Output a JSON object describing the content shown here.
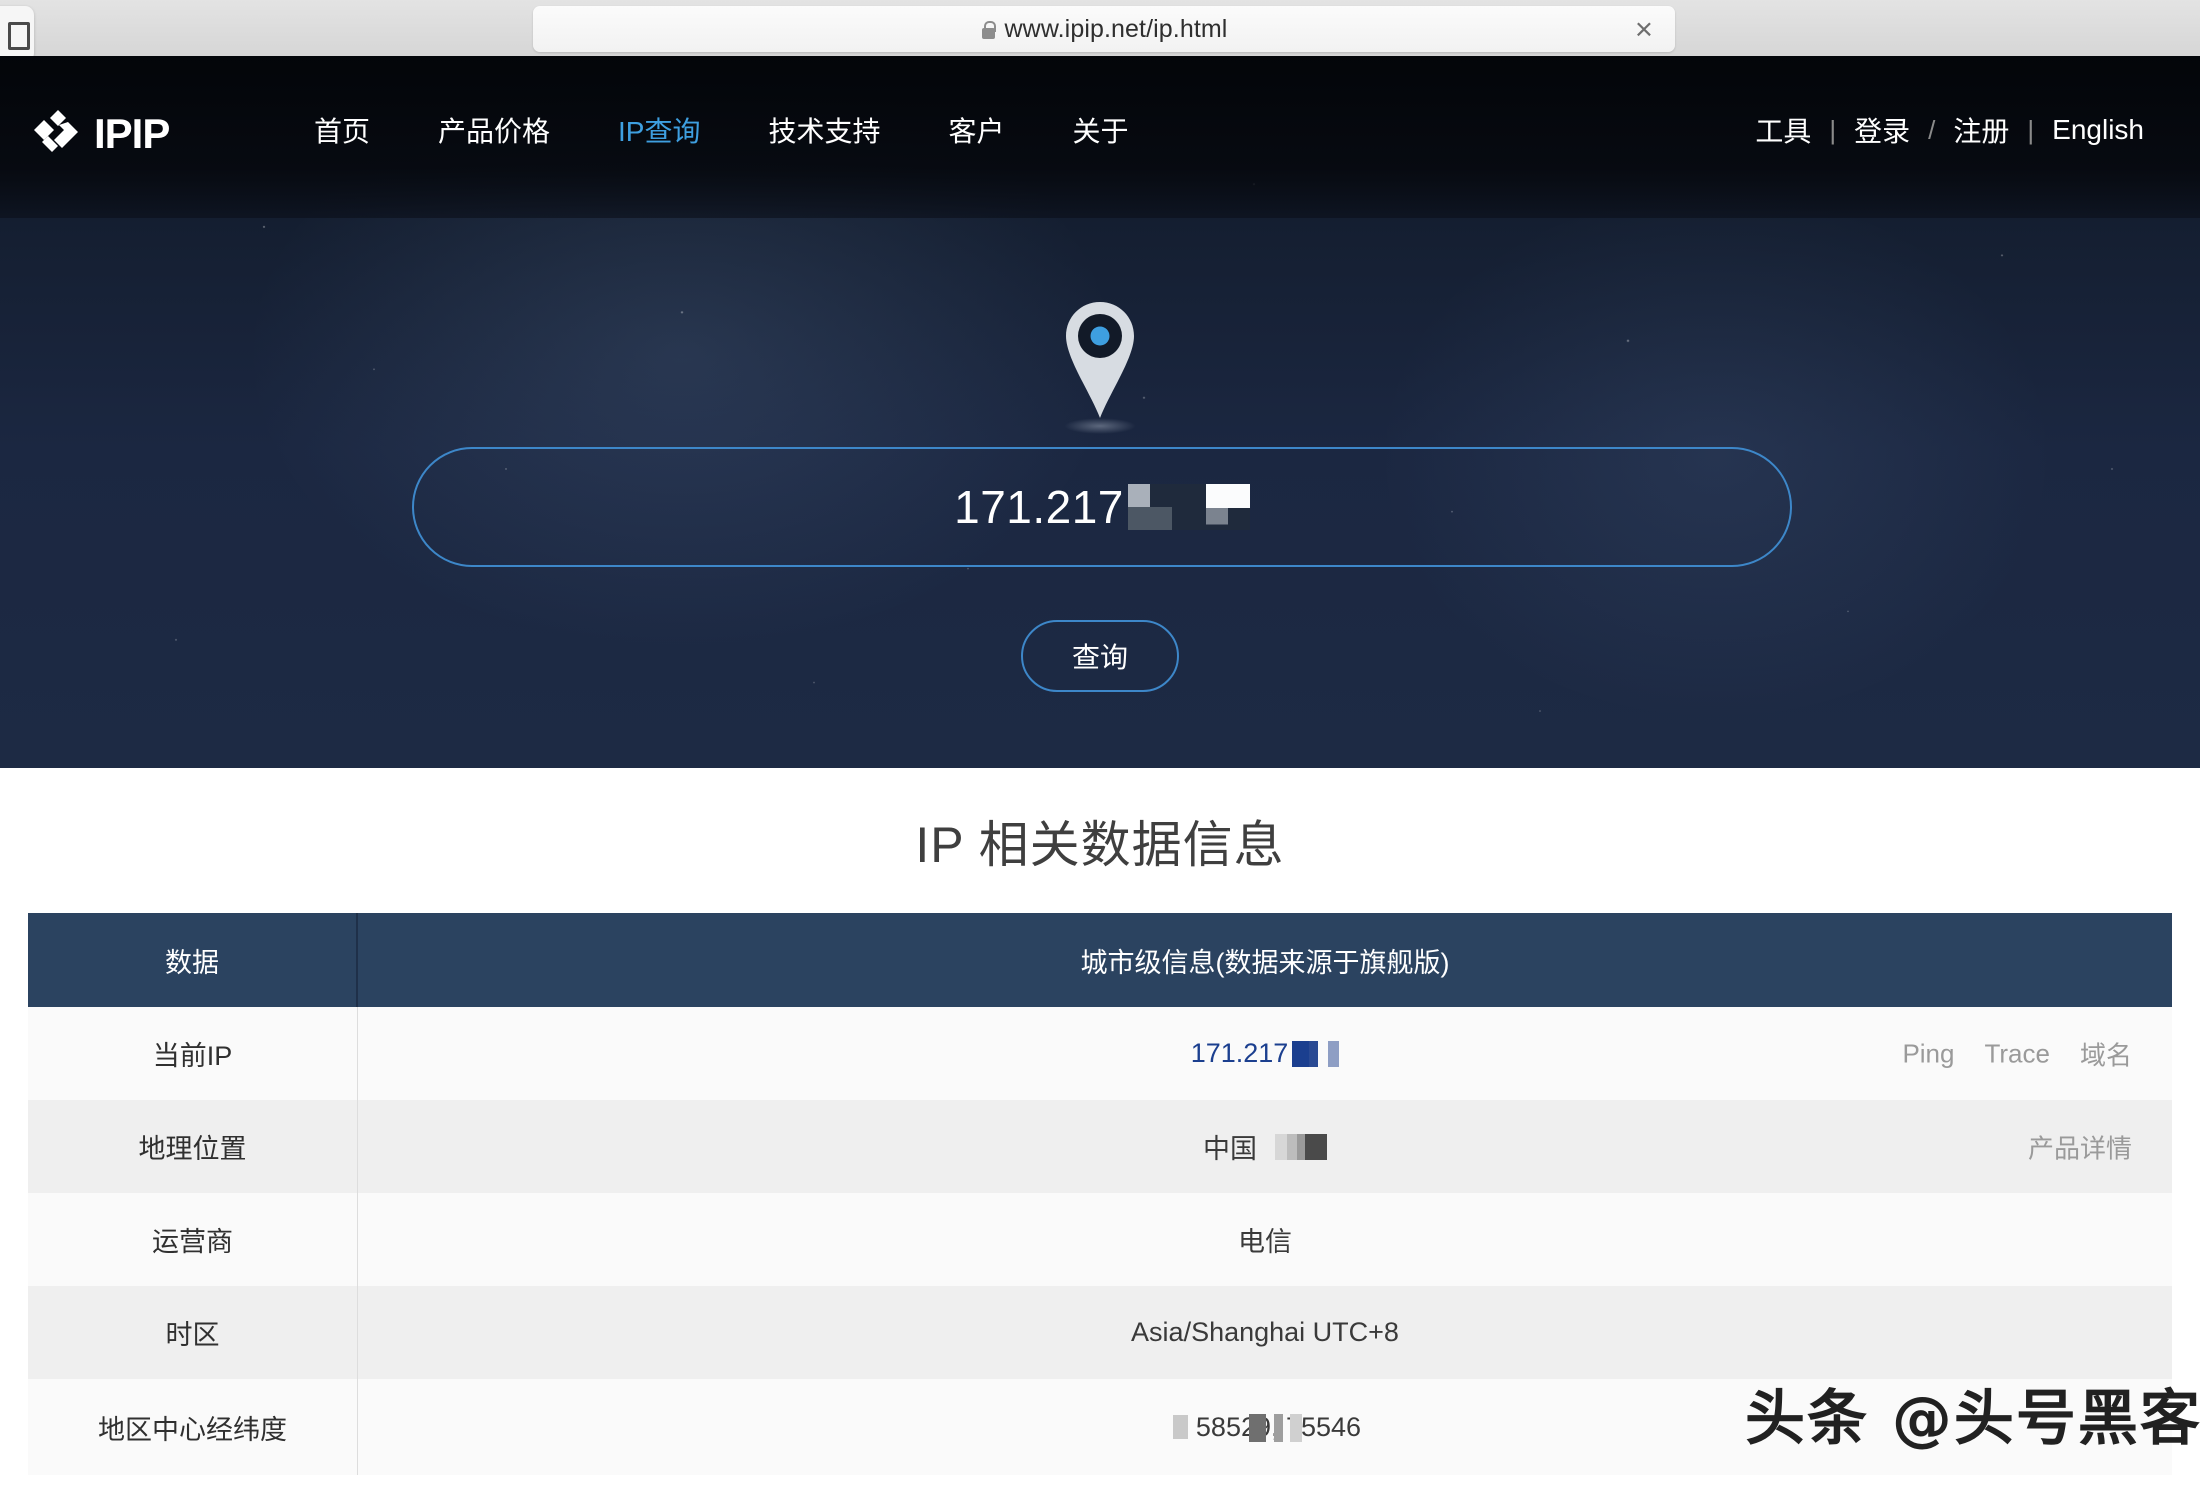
{
  "browser": {
    "url": "www.ipip.net/ip.html",
    "lock_icon": "lock-icon",
    "close_icon": "×"
  },
  "nav": {
    "logo_text": "IPIP",
    "left_items": [
      {
        "label": "首页",
        "active": false
      },
      {
        "label": "产品价格",
        "active": false
      },
      {
        "label": "IP查询",
        "active": true
      },
      {
        "label": "技术支持",
        "active": false
      },
      {
        "label": "客户",
        "active": false
      },
      {
        "label": "关于",
        "active": false
      }
    ],
    "right_items": [
      {
        "label": "工具"
      },
      {
        "label": "登录"
      },
      {
        "label": "注册"
      },
      {
        "label": "English"
      }
    ],
    "separator_1": "|",
    "separator_2": "/",
    "separator_3": "|",
    "active_color": "#3e9fe0"
  },
  "hero": {
    "pin_icon": "map-pin-icon",
    "ip_value": "171.217",
    "query_button": "查询",
    "border_color": "#3d87c9"
  },
  "section": {
    "title": "IP 相关数据信息"
  },
  "table": {
    "header": {
      "label": "数据",
      "value": "城市级信息(数据来源于旗舰版)"
    },
    "header_bg": "#2b4360",
    "rows": [
      {
        "label": "当前IP",
        "value": "171.217",
        "value_is_link": true,
        "redacted": true,
        "actions": [
          "Ping",
          "Trace",
          "域名"
        ]
      },
      {
        "label": "地理位置",
        "value": "中国",
        "value_is_link": false,
        "redacted": true,
        "actions": [
          "产品详情"
        ]
      },
      {
        "label": "运营商",
        "value": "电信",
        "value_is_link": false,
        "redacted": false,
        "actions": []
      },
      {
        "label": "时区",
        "value": "Asia/Shanghai UTC+8",
        "value_is_link": false,
        "redacted": false,
        "actions": []
      },
      {
        "label": "地区中心经纬度",
        "value": "58529,  75546",
        "value_is_link": false,
        "redacted": true,
        "actions": []
      }
    ]
  },
  "watermark": {
    "text": "头条 @头号黑客"
  }
}
